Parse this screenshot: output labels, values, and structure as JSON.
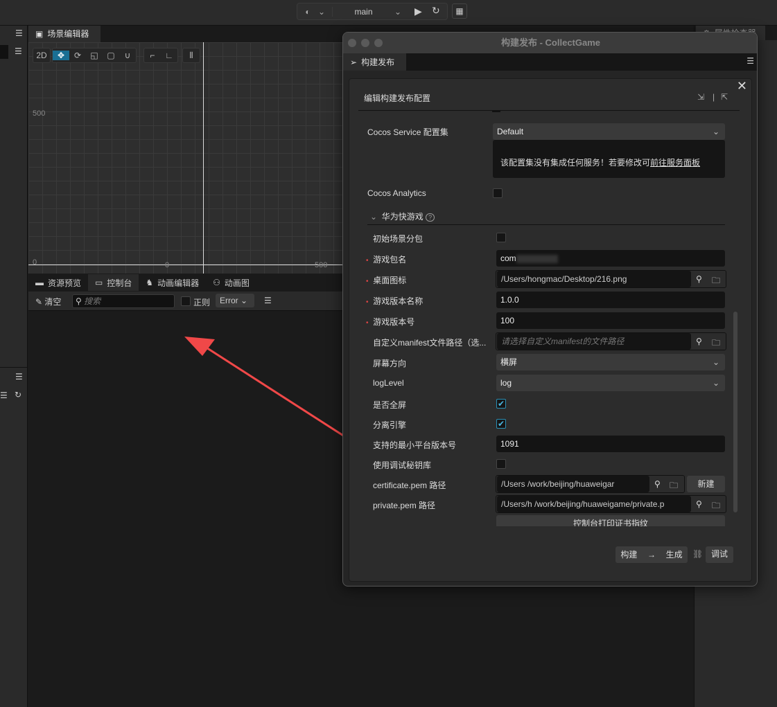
{
  "topbar": {
    "scene_name": "main"
  },
  "scene_editor": {
    "tab": "场景编辑器",
    "mode_2d": "2D",
    "labels": {
      "y500": "500",
      "y0": "0",
      "x0": "0",
      "x500": "500"
    }
  },
  "right_panel": {
    "tab": "属性检查器"
  },
  "console": {
    "tabs": [
      "资源预览",
      "控制台",
      "动画编辑器",
      "动画图"
    ],
    "clear": "清空",
    "search_placeholder": "搜索",
    "regex": "正则",
    "level": "Error"
  },
  "dialog": {
    "window_title": "构建发布 - CollectGame",
    "tab": "构建发布",
    "header": "编辑构建发布配置",
    "service_label": "Cocos Service 配置集",
    "service_value": "Default",
    "service_note": "该配置集没有集成任何服务！若要修改可",
    "service_link": "前往服务面板",
    "analytics_label": "Cocos Analytics",
    "section": "华为快游戏",
    "rows": {
      "subpkg": "初始场景分包",
      "pkg_name": "游戏包名",
      "pkg_value": "com",
      "icon": "桌面图标",
      "icon_value": "/Users/hongmac/Desktop/216.png",
      "ver_name": "游戏版本名称",
      "ver_name_value": "1.0.0",
      "ver_code": "游戏版本号",
      "ver_code_value": "100",
      "manifest": "自定义manifest文件路径（选...",
      "manifest_placeholder": "请选择自定义manifest的文件路径",
      "orientation": "屏幕方向",
      "orientation_value": "横屏",
      "loglevel": "logLevel",
      "loglevel_value": "log",
      "fullscreen": "是否全屏",
      "separate": "分离引擎",
      "minver": "支持的最小平台版本号",
      "minver_value": "1091",
      "debugkey": "使用调试秘钥库",
      "cert": "certificate.pem 路径",
      "cert_value": "/Users        /work/beijing/huaweigar",
      "new_btn": "新建",
      "priv": "private.pem 路径",
      "priv_value": "/Users/h        /work/beijing/huaweigame/private.p",
      "print_btn": "控制台打印证书指纹"
    },
    "build": "构建",
    "make": "生成",
    "debug": "调试"
  },
  "colors": {
    "accent": "#1a6f94",
    "arrow": "#f04848"
  }
}
